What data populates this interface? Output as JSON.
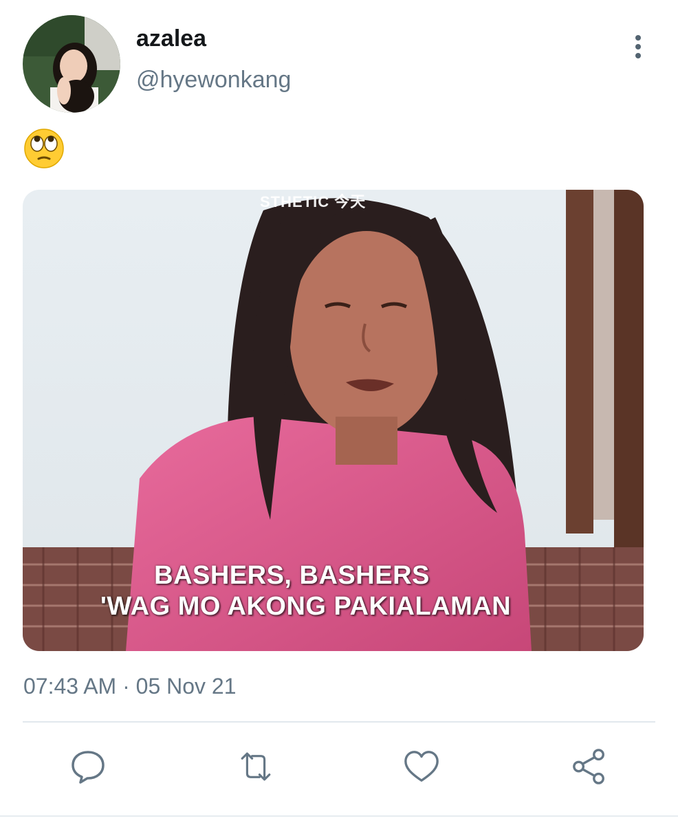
{
  "user": {
    "display_name": "azalea",
    "handle": "@hyewonkang",
    "avatar_icon": "profile-photo"
  },
  "tweet": {
    "text_emoji": "face-with-rolling-eyes-emoji",
    "timestamp": "07:43 AM · 05 Nov 21"
  },
  "media": {
    "watermark": "STHETIC 今天",
    "caption_line1": "BASHERS, BASHERS",
    "caption_line2": "'WAG MO AKONG PAKIALAMAN"
  },
  "actions": {
    "reply_icon": "speech-bubble-icon",
    "retweet_icon": "retweet-icon",
    "like_icon": "heart-icon",
    "share_icon": "share-icon"
  },
  "colors": {
    "secondary_text": "#657786",
    "primary_text": "#14171a",
    "icon": "#657786",
    "divider": "#e1e8ed"
  }
}
